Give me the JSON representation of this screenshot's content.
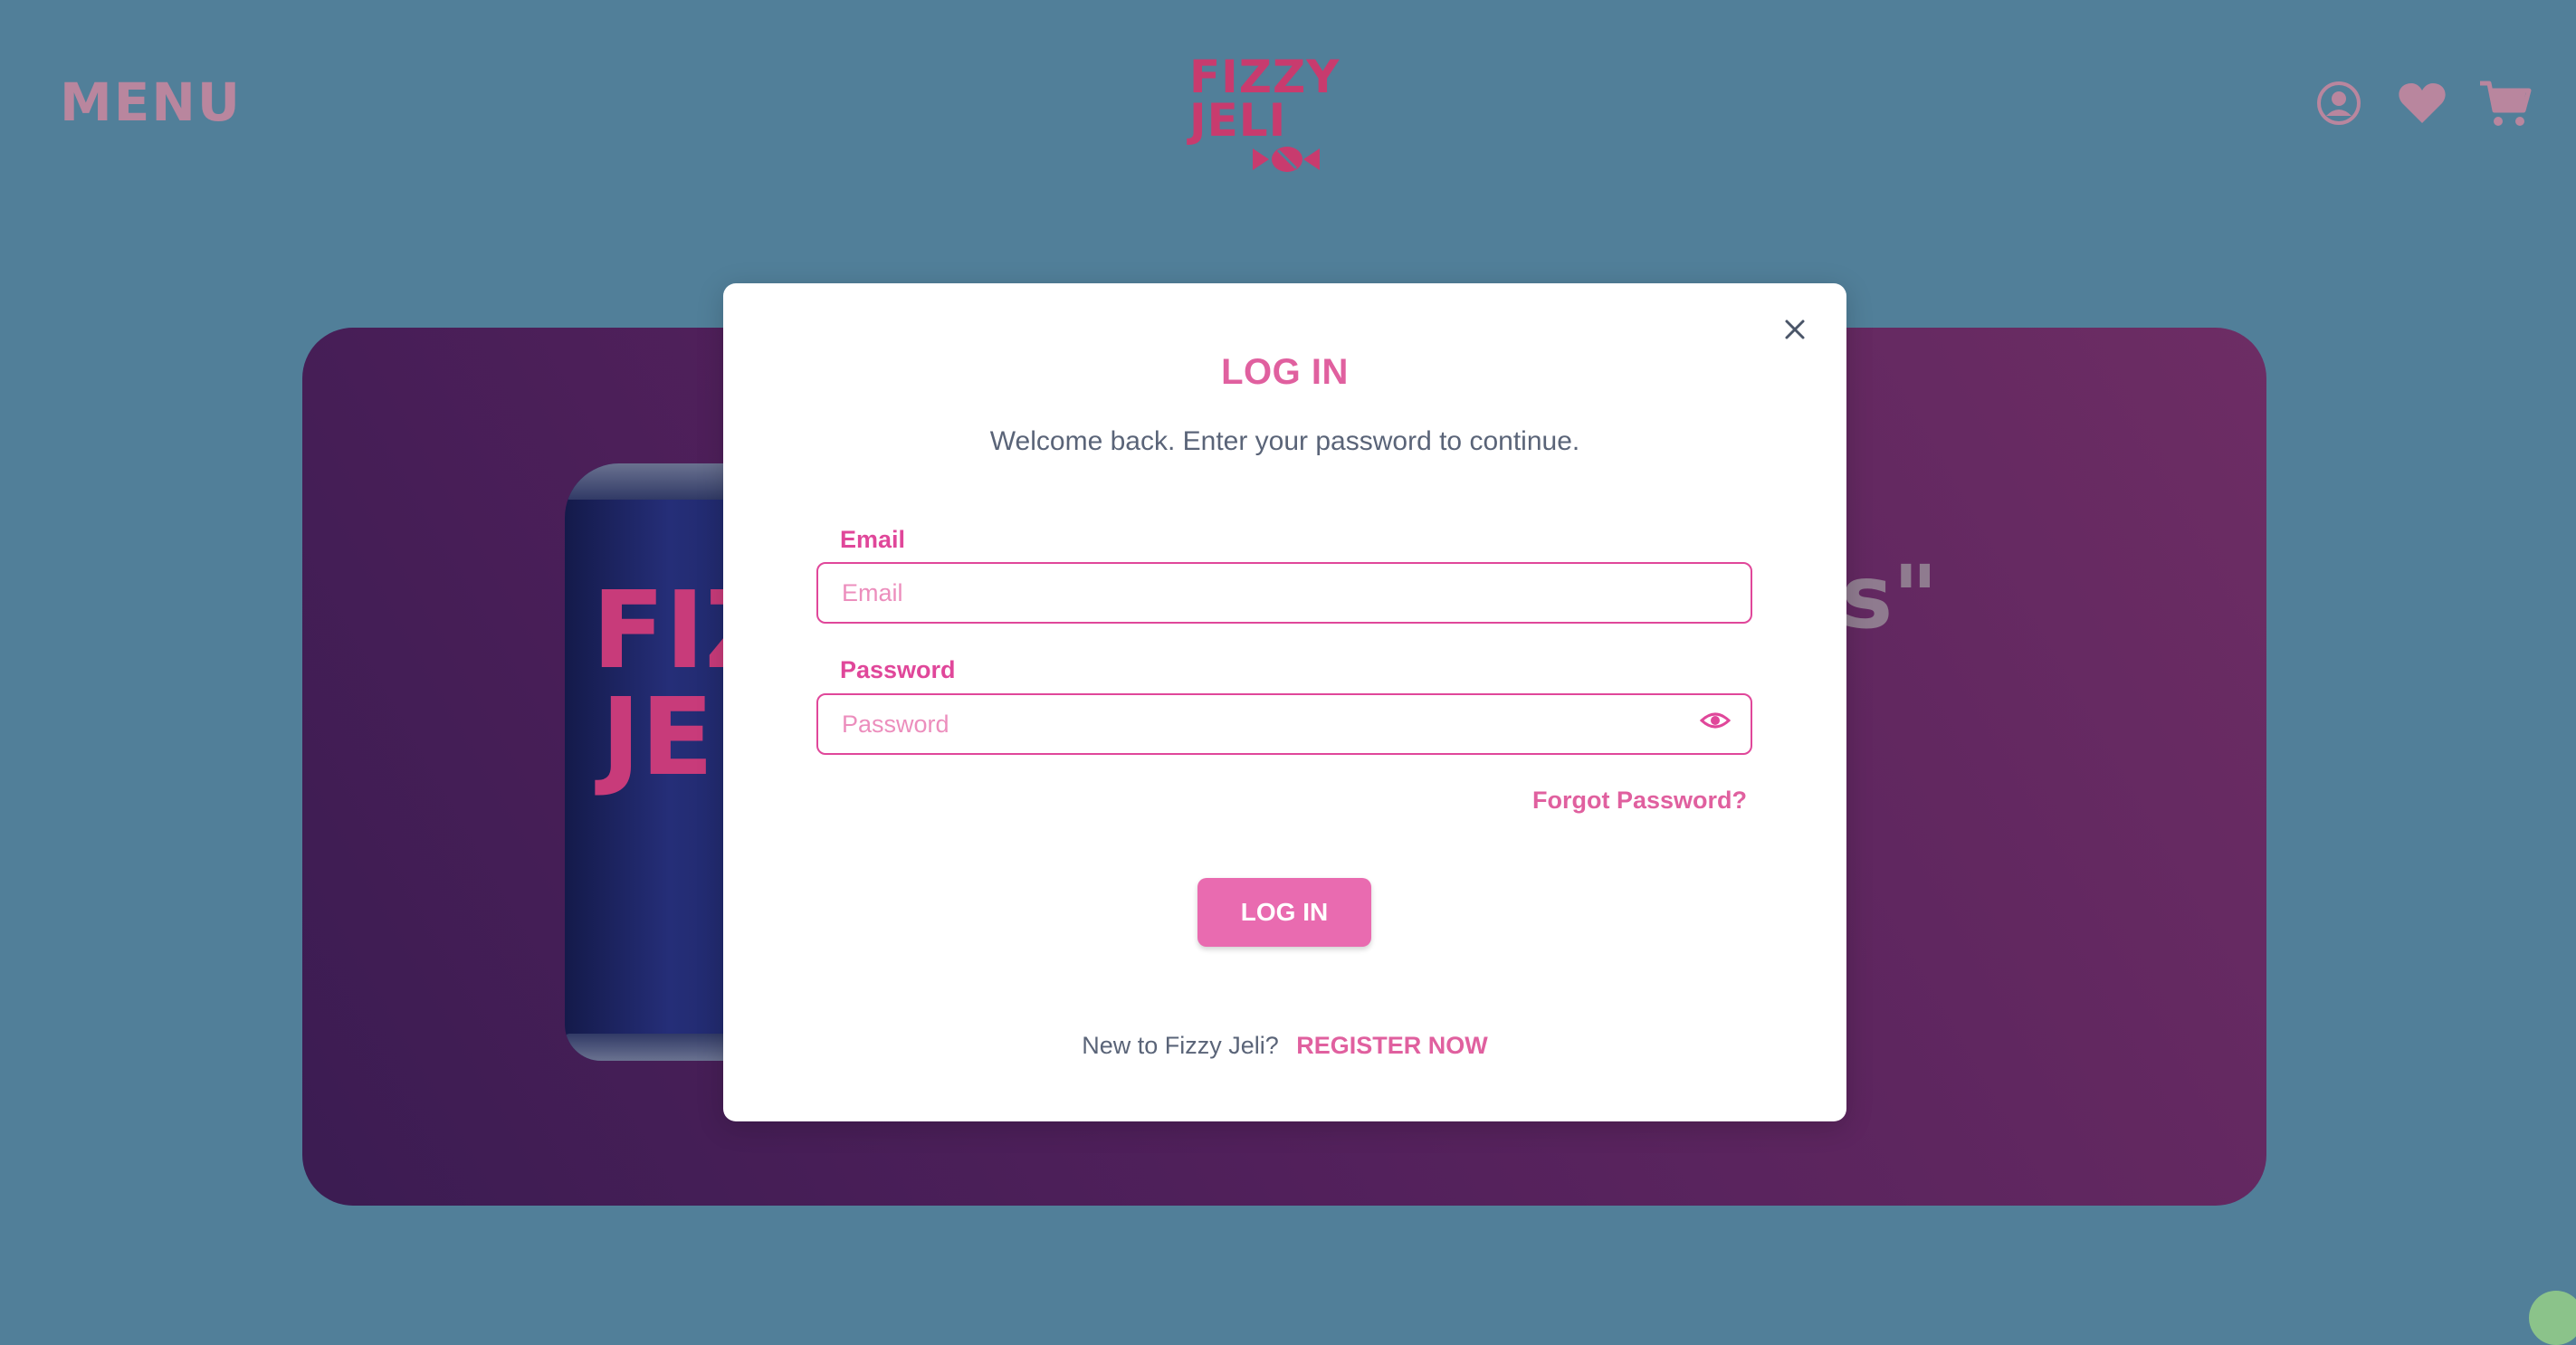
{
  "header": {
    "menu_label": "MENU",
    "logo_line1": "FIZZY",
    "logo_line2": "JELI",
    "icons": [
      "account-icon",
      "heart-icon",
      "cart-icon"
    ]
  },
  "hero": {
    "can_text_line1": "FIZ",
    "can_text_line2": "JE",
    "quote_fragment": "s\""
  },
  "login_modal": {
    "title": "LOG IN",
    "subtitle": "Welcome back. Enter your password to continue.",
    "email": {
      "label": "Email",
      "placeholder": "Email",
      "value": ""
    },
    "password": {
      "label": "Password",
      "placeholder": "Password",
      "value": ""
    },
    "forgot_password": "Forgot Password?",
    "submit_label": "LOG IN",
    "register_prompt": "New to Fizzy Jeli?",
    "register_link": "REGISTER NOW"
  },
  "colors": {
    "page_background": "#517f99",
    "accent_pink": "#e0609f",
    "button_pink": "#e96bb0",
    "logo_red": "#c83b6e"
  }
}
